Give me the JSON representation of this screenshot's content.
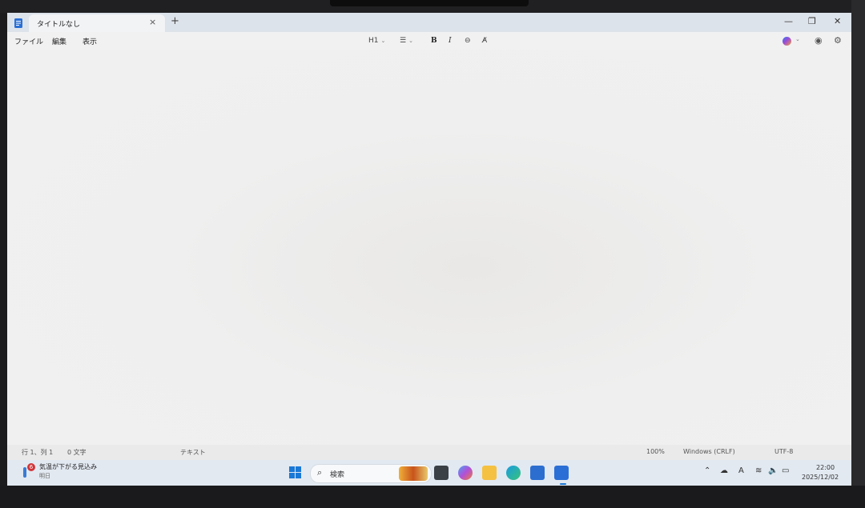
{
  "window": {
    "tab_title": "タイトルなし",
    "tab_close": "×",
    "new_tab": "+",
    "minimize": "—",
    "maximize": "❐",
    "close": "✕"
  },
  "menu": {
    "file": "ファイル",
    "edit": "編集",
    "view": "表示"
  },
  "toolbar": {
    "heading": "H1",
    "list": "☰",
    "bold": "B",
    "italic": "I",
    "link": "⊖",
    "clear_format": "A̸"
  },
  "status": {
    "position": "行 1、列 1",
    "char_count": "0 文字",
    "format": "テキスト",
    "zoom": "100%",
    "line_ending": "Windows (CRLF)",
    "encoding": "UTF-8"
  },
  "taskbar": {
    "weather_badge": "6",
    "weather_title": "気温が下がる見込み",
    "weather_sub": "明日",
    "search_placeholder": "検索",
    "clock_time": "22:00",
    "clock_date": "2025/12/02",
    "ime": "A"
  },
  "colors": {
    "accent": "#1a78d6",
    "badge": "#d13438"
  }
}
